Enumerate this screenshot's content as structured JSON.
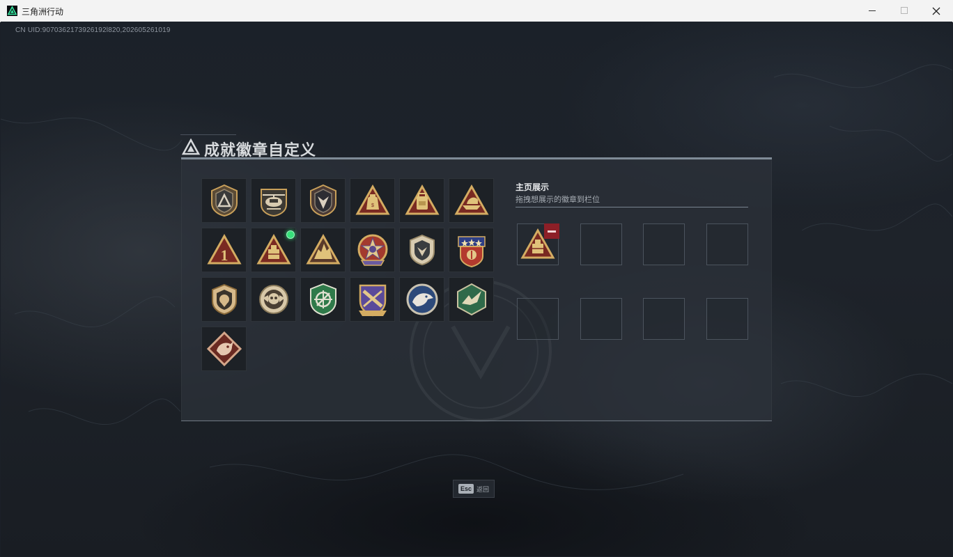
{
  "window": {
    "title": "三角洲行动",
    "controls": [
      "minimize",
      "maximize",
      "close"
    ]
  },
  "uid_text": "CN UID:9070362173926192l820,202605261019",
  "panel": {
    "title": "成就徽章自定义"
  },
  "badges": [
    {
      "icon": "shield-triangle-badge-icon",
      "new": false
    },
    {
      "icon": "helicopter-badge-icon",
      "new": false
    },
    {
      "icon": "shield-arrow-badge-icon",
      "new": false
    },
    {
      "icon": "money-bag-triangle-badge-icon",
      "new": false
    },
    {
      "icon": "backpack-triangle-badge-icon",
      "new": false
    },
    {
      "icon": "boat-triangle-badge-icon",
      "new": false
    },
    {
      "icon": "number-one-triangle-badge-icon",
      "new": false
    },
    {
      "icon": "cargo-triangle-badge-icon",
      "new": true
    },
    {
      "icon": "dinosaur-triangle-badge-icon",
      "new": false
    },
    {
      "icon": "star-wreath-badge-icon",
      "new": false
    },
    {
      "icon": "shield-emblem-badge-icon",
      "new": false
    },
    {
      "icon": "stars-crest-badge-icon",
      "new": false
    },
    {
      "icon": "lion-shield-badge-icon",
      "new": false
    },
    {
      "icon": "skull-wings-badge-icon",
      "new": false
    },
    {
      "icon": "crosshair-shield-badge-icon",
      "new": false
    },
    {
      "icon": "purple-crest-badge-icon",
      "new": false
    },
    {
      "icon": "eagle-head-badge-icon",
      "new": false
    },
    {
      "icon": "green-hexagon-bird-badge-icon",
      "new": false
    },
    {
      "icon": "dragon-diamond-badge-icon",
      "new": false
    }
  ],
  "showcase": {
    "title": "主页展示",
    "subtitle": "拖拽想展示的徽章到栏位",
    "slots": [
      {
        "badge": "cargo-triangle-badge-icon",
        "removable": true
      },
      {
        "badge": null
      },
      {
        "badge": null
      },
      {
        "badge": null
      },
      {
        "badge": null
      },
      {
        "badge": null
      },
      {
        "badge": null
      },
      {
        "badge": null
      }
    ]
  },
  "footer": {
    "esc_key": "Esc",
    "esc_label": "返回"
  },
  "colors": {
    "accent_gold": "#c9a05a",
    "badge_red": "#8b2a24",
    "new_dot": "#36e07a",
    "remove_red": "#8d1f27"
  }
}
